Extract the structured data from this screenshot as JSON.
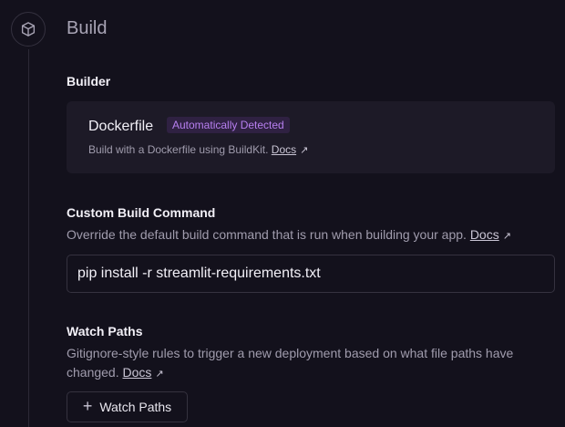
{
  "section": {
    "title": "Build",
    "icon": "cube-icon"
  },
  "builder": {
    "label": "Builder",
    "name": "Dockerfile",
    "badge": "Automatically Detected",
    "description": "Build with a Dockerfile using BuildKit.",
    "docs_label": "Docs"
  },
  "custom_build": {
    "label": "Custom Build Command",
    "description": "Override the default build command that is run when building your app.",
    "docs_label": "Docs",
    "value": "pip install -r streamlit-requirements.txt"
  },
  "watch_paths": {
    "label": "Watch Paths",
    "description": "Gitignore-style rules to trigger a new deployment based on what file paths have changed.",
    "docs_label": "Docs",
    "button_label": "Watch Paths"
  },
  "colors": {
    "background": "#13111c",
    "card": "#1d1a27",
    "badge_text": "#b77ff0",
    "badge_bg": "#2f2142"
  }
}
